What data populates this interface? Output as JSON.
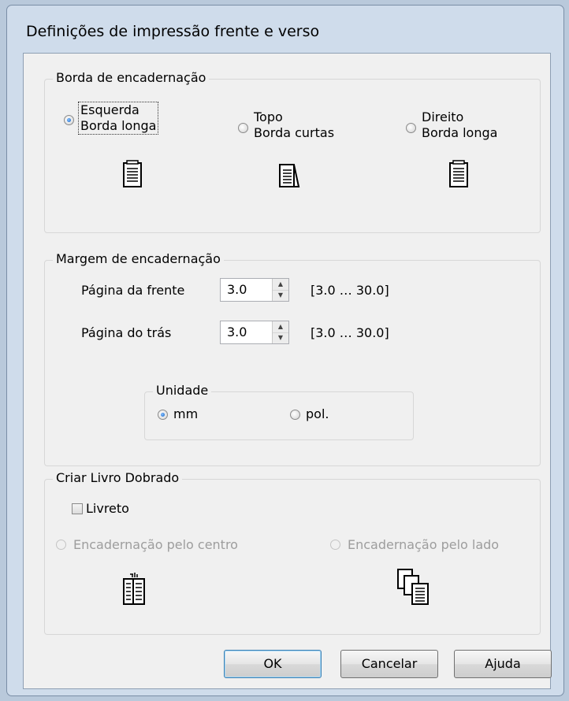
{
  "dialog": {
    "title": "Definições de impressão frente e verso"
  },
  "binding_edge": {
    "label": "Borda de encadernação",
    "options": [
      {
        "line1": "Esquerda",
        "line2": "Borda longa",
        "selected": true,
        "icon": "document-long-edge-icon"
      },
      {
        "line1": "Topo",
        "line2": "Borda curtas",
        "selected": false,
        "icon": "document-short-edge-icon"
      },
      {
        "line1": "Direito",
        "line2": "Borda longa",
        "selected": false,
        "icon": "document-long-edge-icon"
      }
    ]
  },
  "binding_margin": {
    "label": "Margem de encadernação",
    "front": {
      "label": "Página da frente",
      "value": "3.0",
      "range": "[3.0 … 30.0]"
    },
    "back": {
      "label": "Página do trás",
      "value": "3.0",
      "range": "[3.0 … 30.0]"
    },
    "unit": {
      "label": "Unidade",
      "options": [
        {
          "label": "mm",
          "selected": true
        },
        {
          "label": "pol.",
          "selected": false
        }
      ]
    }
  },
  "folded_booklet": {
    "label": "Criar Livro Dobrado",
    "checkbox_label": "Livreto",
    "checked": false,
    "options": [
      {
        "label": "Encadernação pelo centro",
        "enabled": false,
        "icon": "center-binding-icon"
      },
      {
        "label": "Encadernação pelo lado",
        "enabled": false,
        "icon": "side-binding-icon"
      }
    ]
  },
  "buttons": {
    "ok": "OK",
    "cancel": "Cancelar",
    "help": "Ajuda"
  },
  "colors": {
    "accent": "#2e7bd6",
    "window_frame": "#cfdceb",
    "client_bg": "#f0f0f0"
  }
}
